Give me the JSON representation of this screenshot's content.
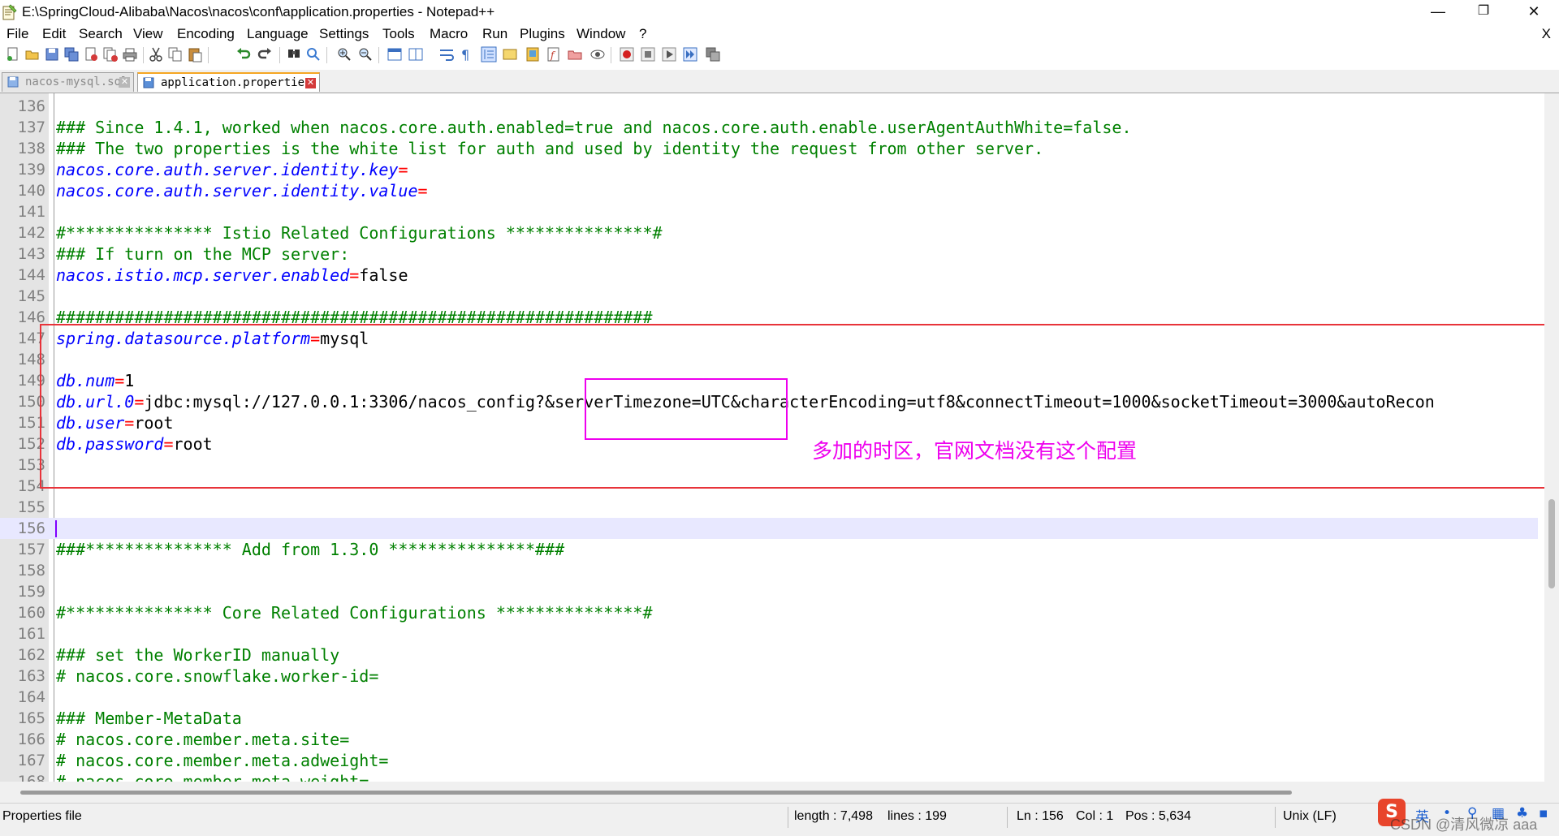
{
  "window": {
    "title": "E:\\SpringCloud-Alibaba\\Nacos\\nacos\\conf\\application.properties - Notepad++",
    "minimize": "—",
    "restore": "❐",
    "close": "✕"
  },
  "menu": {
    "items": [
      "File",
      "Edit",
      "Search",
      "View",
      "Encoding",
      "Language",
      "Settings",
      "Tools",
      "Macro",
      "Run",
      "Plugins",
      "Window",
      "?"
    ],
    "close_doc": "X"
  },
  "toolbar": {
    "icons": [
      "new-file-icon",
      "open-file-icon",
      "save-icon",
      "save-all-icon",
      "close-icon",
      "close-all-icon",
      "print-icon",
      "cut-icon",
      "copy-icon",
      "paste-icon",
      "undo-icon",
      "redo-icon",
      "find-icon",
      "replace-icon",
      "zoom-in-icon",
      "zoom-out-icon",
      "sync-vertical-icon",
      "sync-horizontal-icon",
      "word-wrap-icon",
      "show-all-characters-icon",
      "indent-guide-icon",
      "define-language-icon",
      "document-map-icon",
      "function-list-icon",
      "folder-as-workspace-icon",
      "monitoring-icon",
      "record-macro-icon",
      "stop-recording-icon",
      "playback-icon",
      "run-macro-multiple-icon",
      "save-macro-icon"
    ]
  },
  "tabs": [
    {
      "label": "nacos-mysql.sql",
      "active": false
    },
    {
      "label": "application.properties",
      "active": true
    }
  ],
  "editor": {
    "current_line": "156",
    "lines": [
      {
        "num": "136",
        "segs": []
      },
      {
        "num": "137",
        "segs": [
          {
            "t": "### Since 1.4.1, worked when nacos.core.auth.enabled=true and nacos.core.auth.enable.userAgentAuthWhite=false.",
            "c": "cmt"
          }
        ]
      },
      {
        "num": "138",
        "segs": [
          {
            "t": "### The two properties is the white list for auth and used by identity the request from other server.",
            "c": "cmt"
          }
        ]
      },
      {
        "num": "139",
        "segs": [
          {
            "t": "nacos.core.auth.server.identity.key",
            "c": "key"
          },
          {
            "t": "=",
            "c": "eq"
          }
        ]
      },
      {
        "num": "140",
        "segs": [
          {
            "t": "nacos.core.auth.server.identity.value",
            "c": "key"
          },
          {
            "t": "=",
            "c": "eq"
          }
        ]
      },
      {
        "num": "141",
        "segs": []
      },
      {
        "num": "142",
        "segs": [
          {
            "t": "#*************** Istio Related Configurations ***************#",
            "c": "cmt"
          }
        ]
      },
      {
        "num": "143",
        "segs": [
          {
            "t": "### If turn on the MCP server:",
            "c": "cmt"
          }
        ]
      },
      {
        "num": "144",
        "segs": [
          {
            "t": "nacos.istio.mcp.server.enabled",
            "c": "key"
          },
          {
            "t": "=",
            "c": "eq"
          },
          {
            "t": "false",
            "c": "val"
          }
        ]
      },
      {
        "num": "145",
        "segs": []
      },
      {
        "num": "146",
        "segs": [
          {
            "t": "#############################################################",
            "c": "cmt"
          }
        ]
      },
      {
        "num": "147",
        "segs": [
          {
            "t": "spring.datasource.platform",
            "c": "key"
          },
          {
            "t": "=",
            "c": "eq"
          },
          {
            "t": "mysql",
            "c": "val"
          }
        ]
      },
      {
        "num": "148",
        "segs": []
      },
      {
        "num": "149",
        "segs": [
          {
            "t": "db.num",
            "c": "key"
          },
          {
            "t": "=",
            "c": "eq"
          },
          {
            "t": "1",
            "c": "val"
          }
        ]
      },
      {
        "num": "150",
        "segs": [
          {
            "t": "db.url.0",
            "c": "key"
          },
          {
            "t": "=",
            "c": "eq"
          },
          {
            "t": "jdbc:mysql://127.0.0.1:3306/nacos_config?&serverTimezone=UTC&characterEncoding=utf8&connectTimeout=1000&socketTimeout=3000&autoRecon",
            "c": "val"
          }
        ]
      },
      {
        "num": "151",
        "segs": [
          {
            "t": "db.user",
            "c": "key"
          },
          {
            "t": "=",
            "c": "eq"
          },
          {
            "t": "root",
            "c": "val"
          }
        ]
      },
      {
        "num": "152",
        "segs": [
          {
            "t": "db.password",
            "c": "key"
          },
          {
            "t": "=",
            "c": "eq"
          },
          {
            "t": "root",
            "c": "val"
          }
        ]
      },
      {
        "num": "153",
        "segs": []
      },
      {
        "num": "154",
        "segs": []
      },
      {
        "num": "155",
        "segs": []
      },
      {
        "num": "156",
        "segs": []
      },
      {
        "num": "157",
        "segs": [
          {
            "t": "###*************** Add from 1.3.0 ***************###",
            "c": "cmt"
          }
        ]
      },
      {
        "num": "158",
        "segs": []
      },
      {
        "num": "159",
        "segs": []
      },
      {
        "num": "160",
        "segs": [
          {
            "t": "#*************** Core Related Configurations ***************#",
            "c": "cmt"
          }
        ]
      },
      {
        "num": "161",
        "segs": []
      },
      {
        "num": "162",
        "segs": [
          {
            "t": "### set the WorkerID manually",
            "c": "cmt"
          }
        ]
      },
      {
        "num": "163",
        "segs": [
          {
            "t": "# nacos.core.snowflake.worker-id=",
            "c": "cmt"
          }
        ]
      },
      {
        "num": "164",
        "segs": []
      },
      {
        "num": "165",
        "segs": [
          {
            "t": "### Member-MetaData",
            "c": "cmt"
          }
        ]
      },
      {
        "num": "166",
        "segs": [
          {
            "t": "# nacos.core.member.meta.site=",
            "c": "cmt"
          }
        ]
      },
      {
        "num": "167",
        "segs": [
          {
            "t": "# nacos.core.member.meta.adweight=",
            "c": "cmt"
          }
        ]
      },
      {
        "num": "168",
        "segs": [
          {
            "t": "# nacos.core.member.meta.weight=",
            "c": "cmt"
          }
        ]
      }
    ]
  },
  "annotation": "多加的时区，官网文档没有这个配置",
  "status": {
    "file_type": "Properties file",
    "length": "length : 7,498",
    "lines": "lines : 199",
    "ln": "Ln : 156",
    "col": "Col : 1",
    "pos": "Pos : 5,634",
    "eol": "Unix (LF)"
  },
  "tray": {
    "ime_logo": "S",
    "ime_lang": "英",
    "watermark": "CSDN @清风微凉 aaa"
  },
  "colors": {
    "comment": "#008000",
    "key": "#0000ff",
    "operator": "#ff0000",
    "highlight_box": "#e8333a",
    "annotation": "#ee00ee",
    "current_line": "#e8e8ff"
  }
}
